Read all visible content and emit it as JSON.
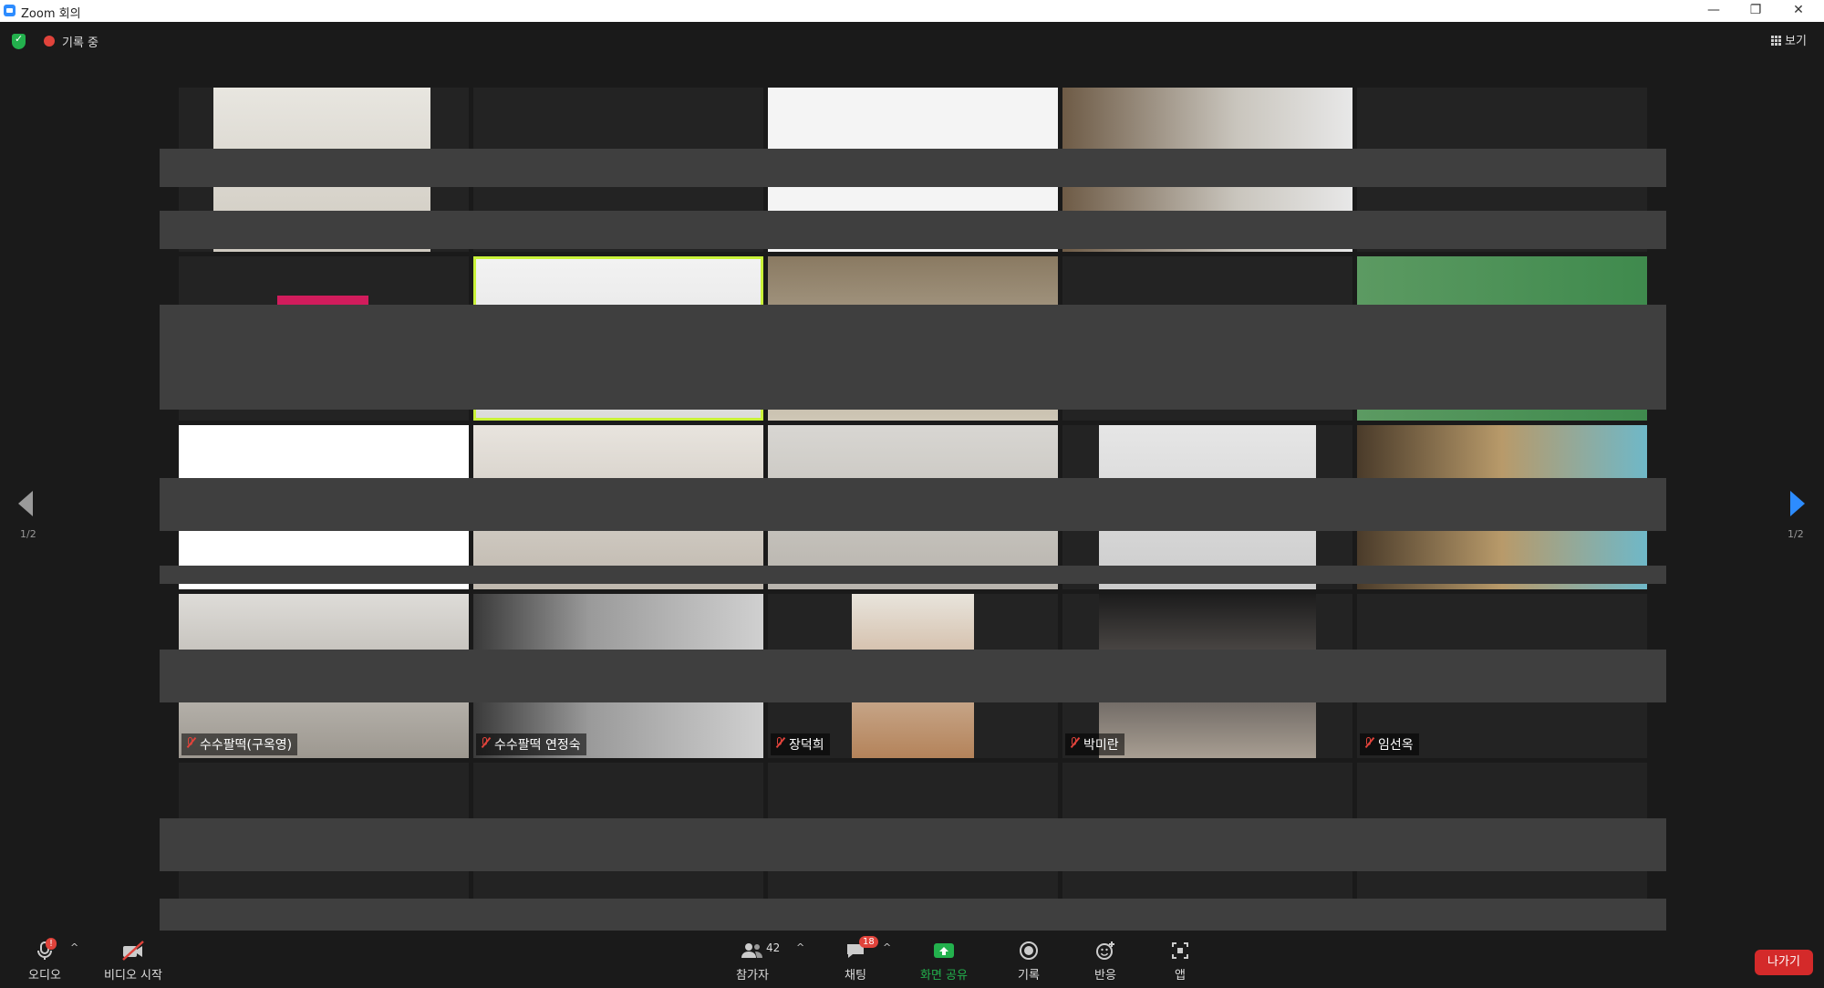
{
  "window": {
    "title": "Zoom 회의",
    "minimize": "—",
    "maximize": "❐",
    "close": "✕"
  },
  "topbar": {
    "recording_label": "기록 중",
    "view_label": "보기"
  },
  "pager": {
    "left": "1/2",
    "right": "1/2"
  },
  "tiles": [
    {
      "name": ""
    },
    {
      "name": ""
    },
    {
      "name": ""
    },
    {
      "name": ""
    },
    {
      "name": ""
    },
    {
      "name": ""
    },
    {
      "name": ""
    },
    {
      "name": ""
    },
    {
      "name": ""
    },
    {
      "name": ""
    },
    {
      "name": ""
    },
    {
      "name": ""
    },
    {
      "name": ""
    },
    {
      "name": ""
    },
    {
      "name": ""
    },
    {
      "name": "수수팔떡(구옥영)"
    },
    {
      "name": "수수팔떡 연정숙"
    },
    {
      "name": "장덕희"
    },
    {
      "name": "박미란"
    },
    {
      "name": "임선옥"
    },
    {
      "name": ""
    },
    {
      "name": ""
    },
    {
      "name": ""
    },
    {
      "name": ""
    },
    {
      "name": ""
    }
  ],
  "toolbar": {
    "audio_label": "오디오",
    "audio_badge": "!",
    "video_label": "비디오 시작",
    "participants_label": "참가자",
    "participants_count": "42",
    "chat_label": "채팅",
    "chat_badge": "18",
    "share_label": "화면 공유",
    "record_label": "기록",
    "reactions_label": "반응",
    "apps_label": "앱",
    "leave_label": "나가기"
  },
  "colors": {
    "accent": "#2d8cff",
    "share_green": "#23b14d",
    "leave_red": "#d42a2a",
    "active_speaker": "#c9f23a"
  }
}
